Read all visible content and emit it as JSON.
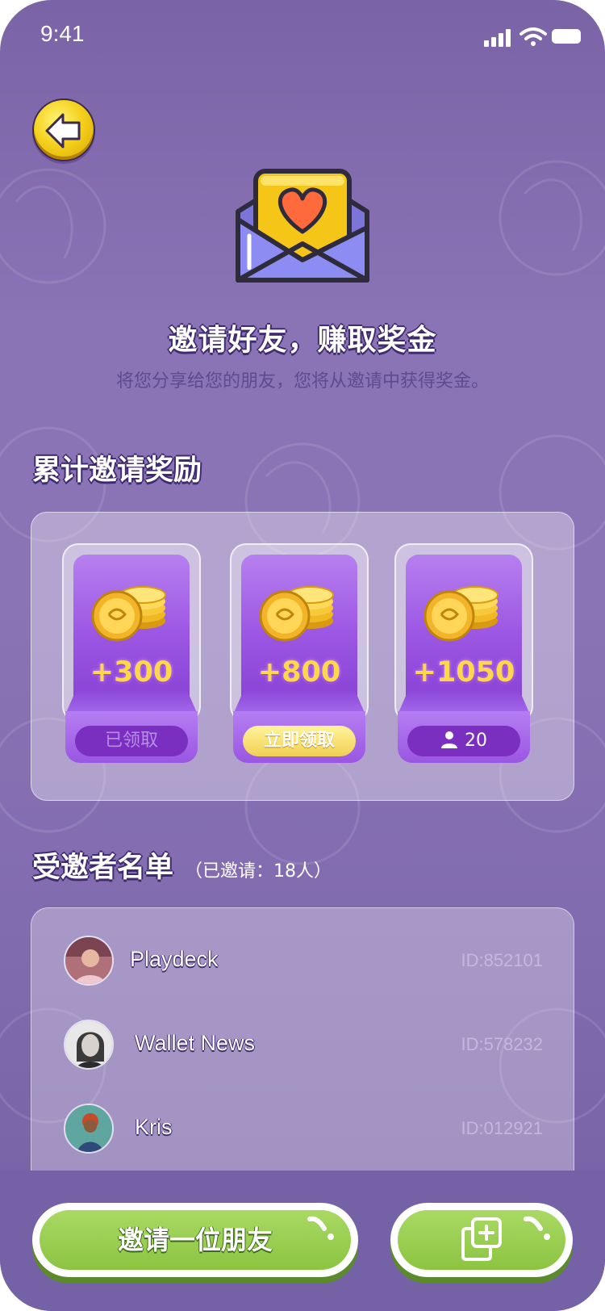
{
  "status_bar": {
    "time": "9:41"
  },
  "hero": {
    "title": "邀请好友，赚取奖金",
    "subtitle": "将您分享给您的朋友，您将从邀请中获得奖金。"
  },
  "rewards": {
    "section_title": "累计邀请奖励",
    "cards": [
      {
        "amount": "+300",
        "action": "已领取",
        "state": "claimed"
      },
      {
        "amount": "+800",
        "action": "立即领取",
        "state": "claimable"
      },
      {
        "amount": "+1050",
        "action": "20",
        "state": "locked"
      }
    ]
  },
  "invitees": {
    "section_title": "受邀者名单",
    "count_note": "（已邀请：18人）",
    "rows": [
      {
        "name": "Playdeck",
        "id": "ID:852101"
      },
      {
        "name": "Wallet News",
        "id": "ID:578232"
      },
      {
        "name": "Kris",
        "id": "ID:012921"
      }
    ]
  },
  "footer": {
    "invite_label": "邀请一位朋友"
  },
  "colors": {
    "background": "#7a63a6",
    "card_purple": "#9c57e3",
    "coin_gold": "#ffd84a",
    "button_green": "#8cc441"
  },
  "icons": [
    "back-arrow-icon",
    "heart-envelope-icon",
    "coins-icon",
    "person-icon",
    "copy-icon",
    "signal-icon",
    "wifi-icon",
    "battery-icon"
  ]
}
